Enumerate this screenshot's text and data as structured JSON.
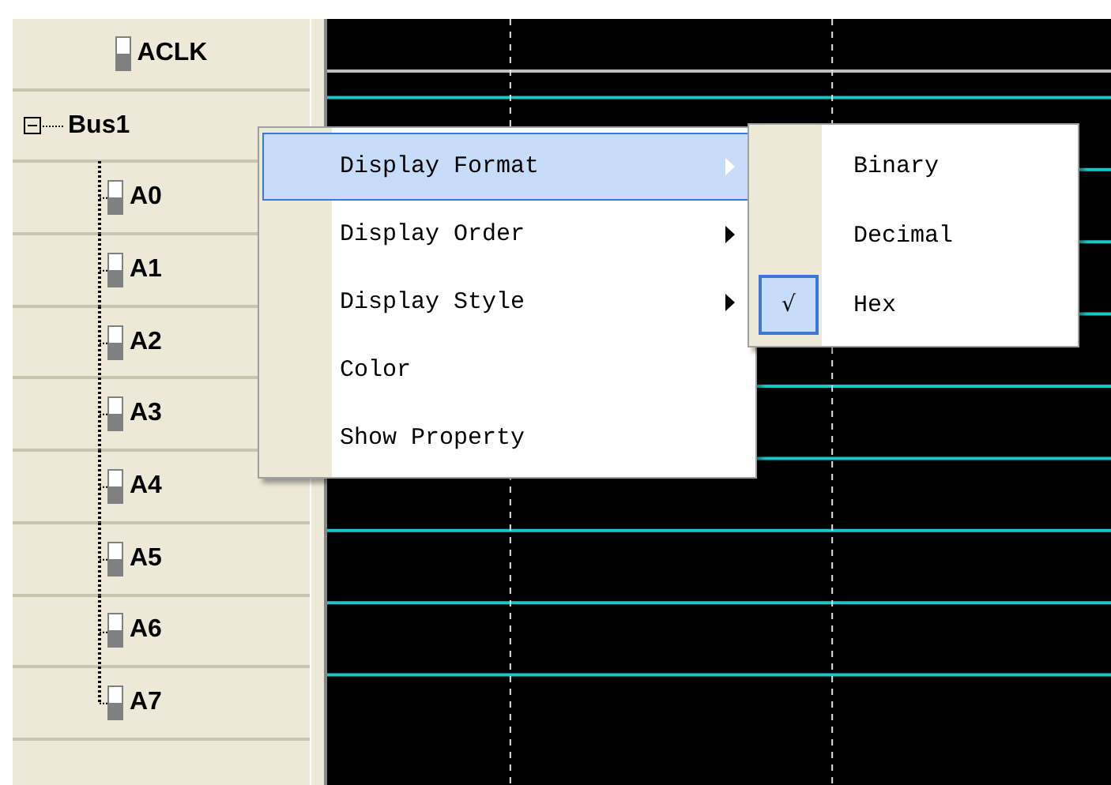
{
  "signals": [
    {
      "name": "ACLK",
      "kind": "signal"
    },
    {
      "name": "Bus1",
      "kind": "bus",
      "expanded": true,
      "children": [
        {
          "name": "A0"
        },
        {
          "name": "A1"
        },
        {
          "name": "A2"
        },
        {
          "name": "A3"
        },
        {
          "name": "A4"
        },
        {
          "name": "A5"
        },
        {
          "name": "A6"
        },
        {
          "name": "A7"
        }
      ]
    }
  ],
  "context_menu": {
    "items": [
      {
        "label": "Display Format",
        "selected": true,
        "submenu": true
      },
      {
        "label": "Display Order",
        "selected": false,
        "submenu": true
      },
      {
        "label": "Display Style",
        "selected": false,
        "submenu": true
      },
      {
        "label": "Color",
        "selected": false,
        "submenu": false
      },
      {
        "label": "Show Property",
        "selected": false,
        "submenu": false
      }
    ]
  },
  "submenu": {
    "items": [
      {
        "label": "Binary",
        "checked": false
      },
      {
        "label": "Decimal",
        "checked": false
      },
      {
        "label": "Hex",
        "checked": true,
        "mark": "√"
      }
    ]
  }
}
